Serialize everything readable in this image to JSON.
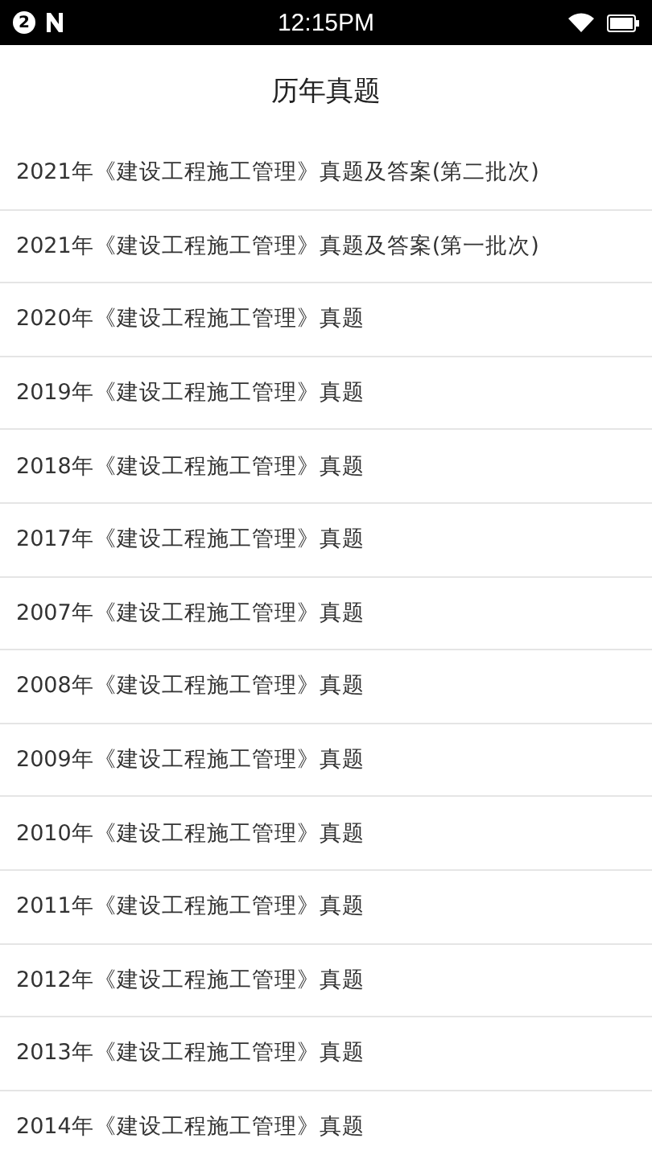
{
  "status_bar": {
    "notification_count": "2",
    "time": "12:15PM"
  },
  "header": {
    "title": "历年真题"
  },
  "items": [
    {
      "label": "2021年《建设工程施工管理》真题及答案(第二批次)"
    },
    {
      "label": "2021年《建设工程施工管理》真题及答案(第一批次)"
    },
    {
      "label": "2020年《建设工程施工管理》真题"
    },
    {
      "label": "2019年《建设工程施工管理》真题"
    },
    {
      "label": "2018年《建设工程施工管理》真题"
    },
    {
      "label": "2017年《建设工程施工管理》真题"
    },
    {
      "label": "2007年《建设工程施工管理》真题"
    },
    {
      "label": "2008年《建设工程施工管理》真题"
    },
    {
      "label": "2009年《建设工程施工管理》真题"
    },
    {
      "label": "2010年《建设工程施工管理》真题"
    },
    {
      "label": "2011年《建设工程施工管理》真题"
    },
    {
      "label": "2012年《建设工程施工管理》真题"
    },
    {
      "label": "2013年《建设工程施工管理》真题"
    },
    {
      "label": "2014年《建设工程施工管理》真题"
    }
  ]
}
